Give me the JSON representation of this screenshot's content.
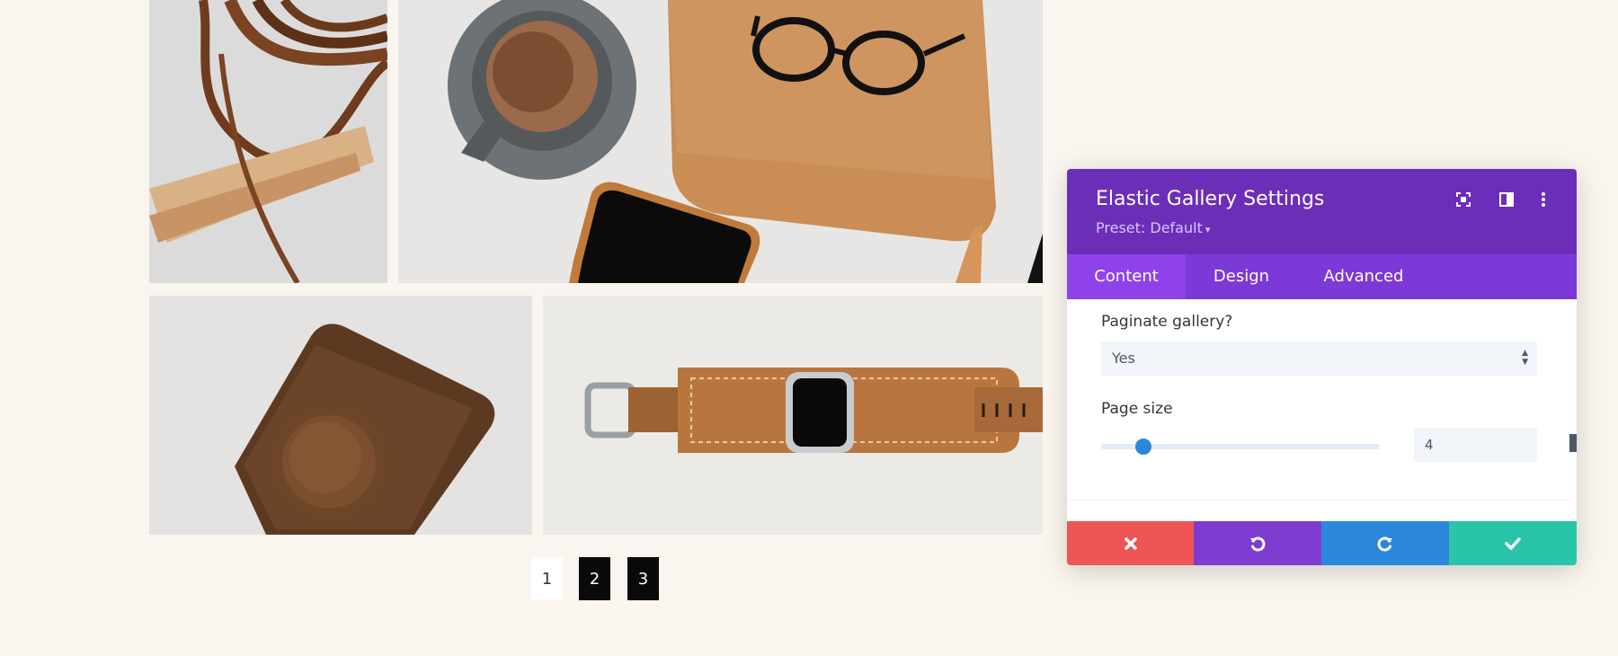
{
  "gallery": {
    "images": [
      {
        "name": "leather-cords-photo"
      },
      {
        "name": "coffee-notebook-photo"
      },
      {
        "name": "camera-case-photo"
      },
      {
        "name": "watch-photo"
      }
    ]
  },
  "pagination": {
    "pages": [
      "1",
      "2",
      "3"
    ],
    "current": "1"
  },
  "panel": {
    "title": "Elastic Gallery Settings",
    "preset": "Preset: Default",
    "header_icons": [
      "fullscreen-icon",
      "split-view-icon",
      "more-options-icon"
    ],
    "tabs": [
      {
        "label": "Content",
        "active": true
      },
      {
        "label": "Design",
        "active": false
      },
      {
        "label": "Advanced",
        "active": false
      }
    ],
    "fields": {
      "paginate_label": "Paginate gallery?",
      "paginate_value": "Yes",
      "page_size_label": "Page size",
      "page_size_value": "4",
      "page_size_slider_fraction": 0.15
    },
    "footer_buttons": [
      {
        "name": "cancel",
        "icon": "close-icon",
        "color": "#ef5555"
      },
      {
        "name": "undo",
        "icon": "undo-icon",
        "color": "#7e3bd0"
      },
      {
        "name": "redo",
        "icon": "redo-icon",
        "color": "#2b87da"
      },
      {
        "name": "save",
        "icon": "check-icon",
        "color": "#29c4a9"
      }
    ]
  },
  "colors": {
    "page_background": "#faf5ee",
    "header": "#6c2eb9",
    "tabs_bar": "#7d39d7",
    "active_tab": "#8f42ec",
    "slider_handle": "#2b87da"
  }
}
